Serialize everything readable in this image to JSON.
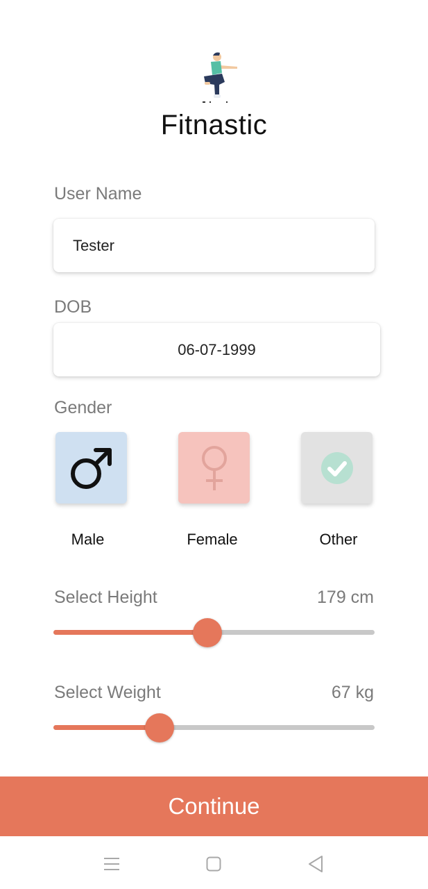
{
  "app": {
    "title": "Fitnastic",
    "logo_icon": "squat-figure-icon"
  },
  "form": {
    "username": {
      "label": "User Name",
      "value": "Tester"
    },
    "dob": {
      "label": "DOB",
      "value": "06-07-1999"
    },
    "gender": {
      "label": "Gender",
      "options": [
        {
          "label": "Male",
          "icon": "male-symbol-icon",
          "color": "#cfe0f1"
        },
        {
          "label": "Female",
          "icon": "female-symbol-icon",
          "color": "#f6c3bd"
        },
        {
          "label": "Other",
          "icon": "check-circle-icon",
          "color": "#e2e2e2"
        }
      ]
    },
    "height": {
      "label": "Select Height",
      "value_text": "179 cm",
      "fraction": 0.48
    },
    "weight": {
      "label": "Select Weight",
      "value_text": "67 kg",
      "fraction": 0.33
    }
  },
  "actions": {
    "continue_label": "Continue"
  },
  "colors": {
    "accent": "#e5775b",
    "track": "#c8c8c8"
  },
  "system_nav": {
    "icons": [
      "menu-icon",
      "home-square-icon",
      "back-triangle-icon"
    ]
  }
}
